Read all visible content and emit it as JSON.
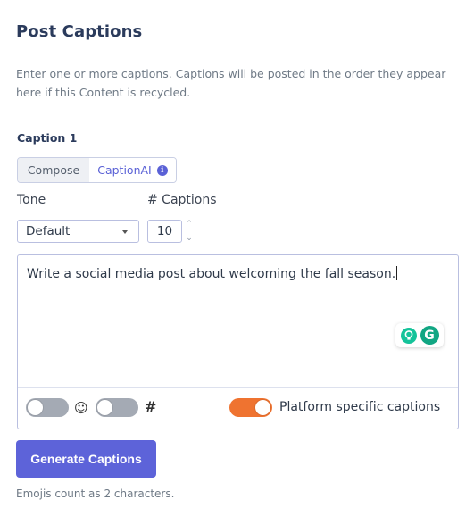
{
  "header": {
    "title": "Post Captions"
  },
  "description": "Enter one or more captions. Captions will be posted in the order they appear here if this Content is recycled.",
  "caption": {
    "label": "Caption 1",
    "tabs": {
      "compose": "Compose",
      "caption_ai": "CaptionAI"
    },
    "tone_label": "Tone",
    "tone_value": "Default",
    "count_label": "# Captions",
    "count_value": "10",
    "prompt_text": "Write a social media post about welcoming the fall season.",
    "grammarly_letter": "G",
    "emoji_glyph": "☺",
    "hashtag_glyph": "#",
    "platform_label": "Platform specific captions",
    "toggles": {
      "emoji": false,
      "hashtags": false,
      "platform_specific": true
    }
  },
  "actions": {
    "generate_label": "Generate Captions"
  },
  "footer_note": "Emojis count as 2 characters.",
  "colors": {
    "accent": "#5d63d9",
    "toggle_on": "#ef7330",
    "toggle_off": "#a4aab4",
    "grammarly": "#15c39a"
  }
}
